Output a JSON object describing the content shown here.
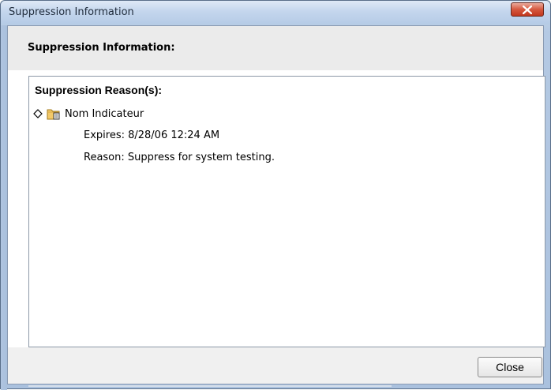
{
  "window": {
    "title": "Suppression Information"
  },
  "header": {
    "title": "Suppression Information:"
  },
  "panel": {
    "heading": "Suppression Reason(s):",
    "items": [
      {
        "label": "Nom Indicateur",
        "expires": "Expires: 8/28/06 12:24 AM",
        "reason": "Reason: Suppress for system testing."
      }
    ]
  },
  "footer": {
    "close_label": "Close"
  },
  "icons": {
    "close": "close-icon",
    "diamond": "diamond-icon",
    "folder": "folder-icon"
  },
  "colors": {
    "titlebar": "#c4d6ed",
    "close_button": "#d5583f",
    "header_bg": "#ebebeb"
  }
}
